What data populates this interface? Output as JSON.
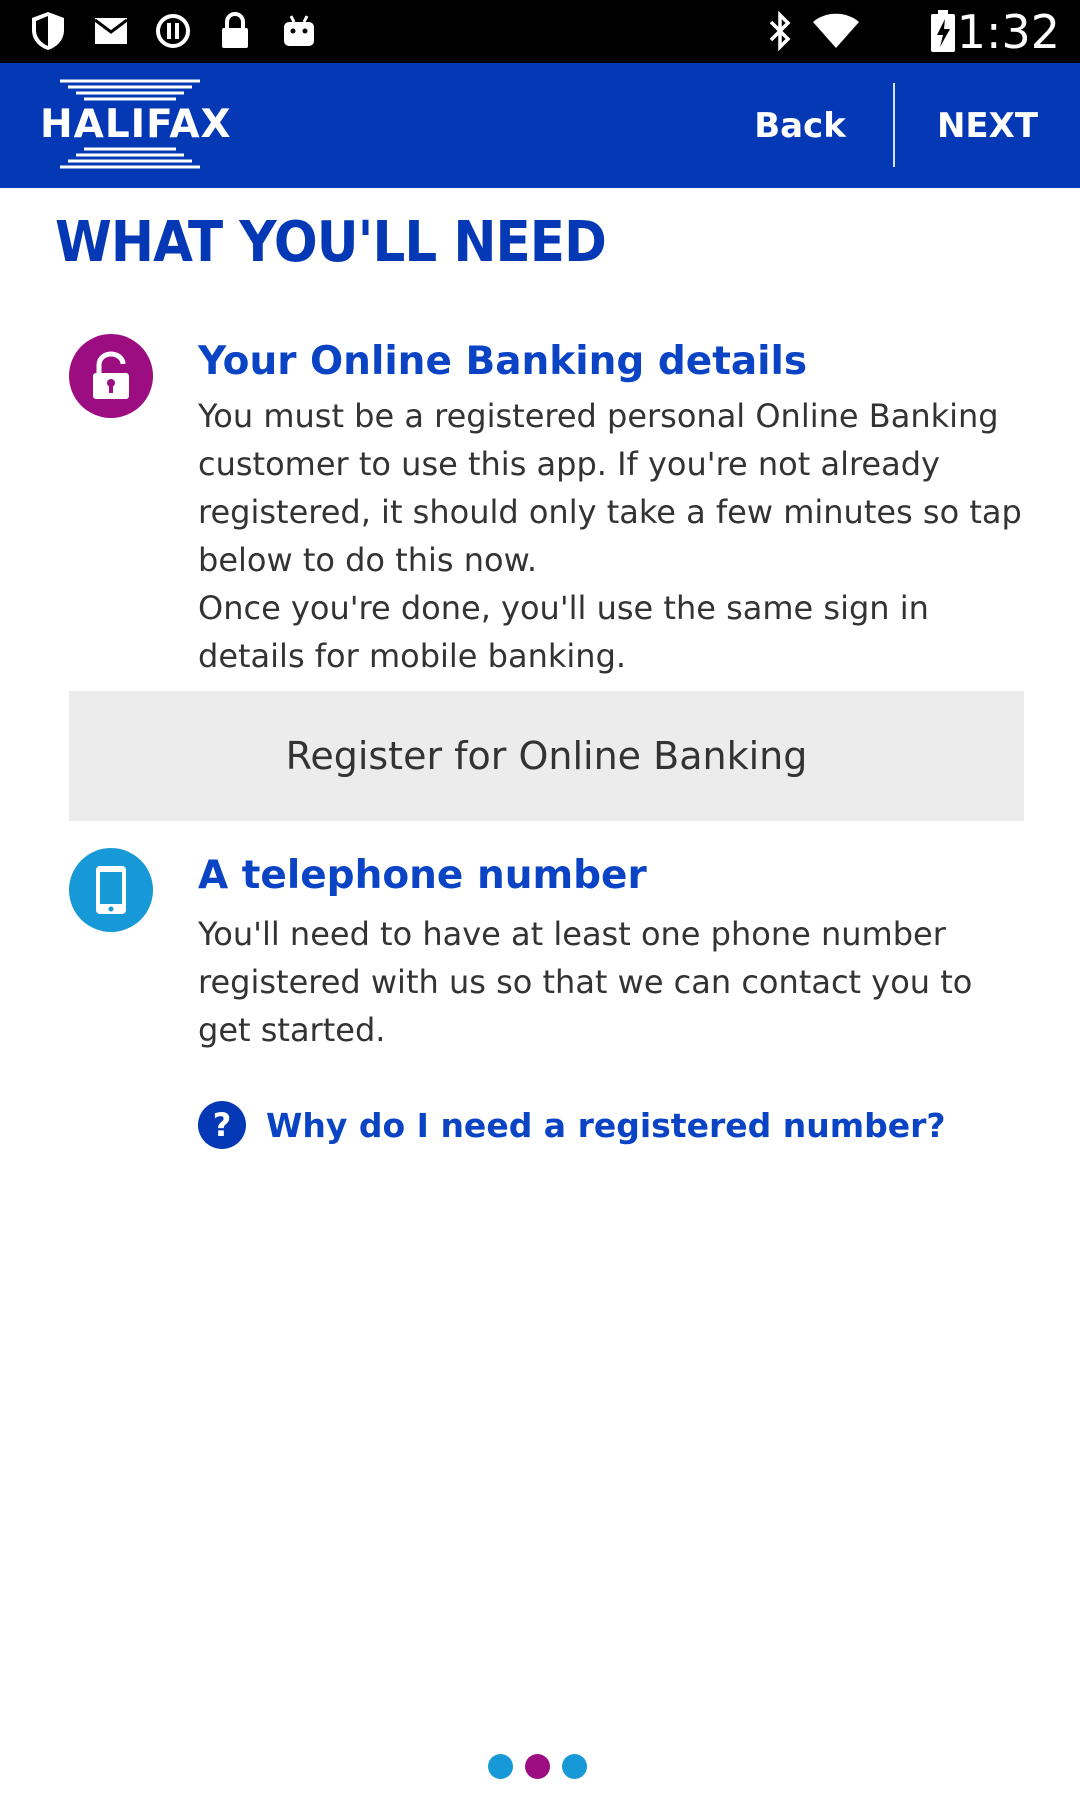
{
  "status_bar": {
    "time": "1:32",
    "left_icons": [
      "shield-icon",
      "mail-icon",
      "alert-circle-icon",
      "lock-icon",
      "android-icon"
    ],
    "right_icons": [
      "bluetooth-icon",
      "wifi-icon",
      "battery-icon"
    ]
  },
  "header": {
    "logo_text": "HALIFAX",
    "back_label": "Back",
    "next_label": "NEXT",
    "color": "#0438b4"
  },
  "page": {
    "title": "WHAT YOU'LL NEED"
  },
  "online_banking": {
    "icon": "padlock-icon",
    "icon_color": "#9b0d80",
    "title": "Your Online Banking details",
    "body_line1": "You must be a registered personal Online Banking customer to use this app. If you're not already registered, it should only take a few minutes so tap below to do this now.",
    "body_line2": "Once you're done, you'll use the same sign in details for mobile banking.",
    "register_button_label": "Register for Online Banking"
  },
  "telephone": {
    "icon": "mobile-phone-icon",
    "icon_color": "#1699d6",
    "title": "A telephone number",
    "body": "You'll need to have at least one phone number registered with us so that we can contact you to get started.",
    "help_link_label": "Why do I need a registered number?",
    "help_icon_glyph": "?"
  },
  "pager": {
    "page_count": 3,
    "current_page": 2,
    "dot_colors": [
      "#1699d6",
      "#9b0d80",
      "#1699d6"
    ]
  }
}
